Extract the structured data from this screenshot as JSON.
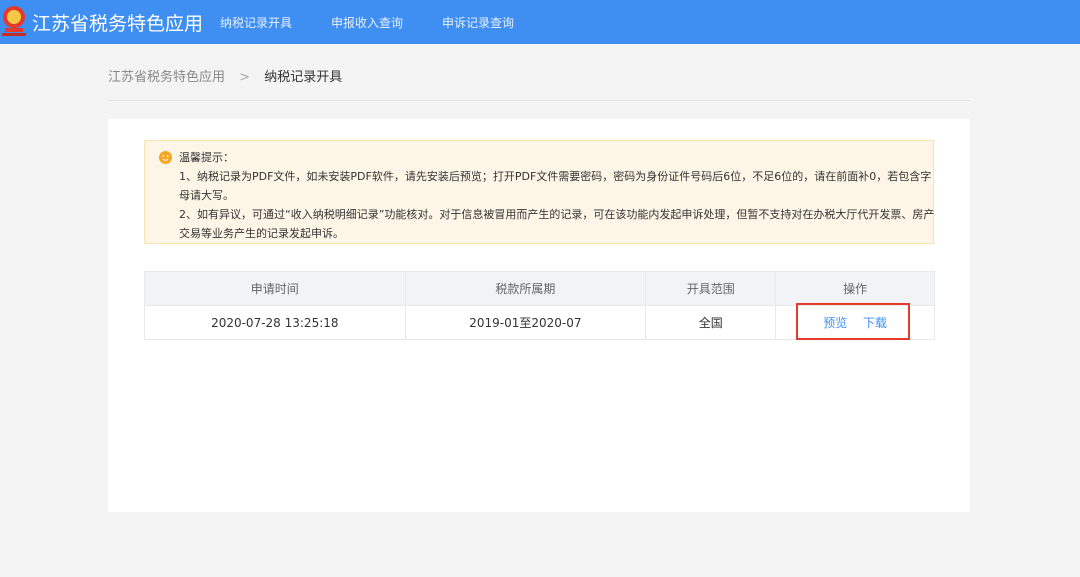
{
  "header": {
    "app_title": "江苏省税务特色应用",
    "nav": [
      "纳税记录开具",
      "申报收入查询",
      "申诉记录查询"
    ]
  },
  "breadcrumb": {
    "root": "江苏省税务特色应用",
    "separator": ">",
    "current": "纳税记录开具"
  },
  "notice": {
    "title": "温馨提示：",
    "line1": "1、纳税记录为PDF文件，如未安装PDF软件，请先安装后预览；打开PDF文件需要密码，密码为身份证件号码后6位，不足6位的，请在前面补0，若包含字母请大写。",
    "line2": "2、如有异议，可通过“收入纳税明细记录”功能核对。对于信息被冒用而产生的记录，可在该功能内发起申诉处理，但暂不支持对在办税大厅代开发票、房产交易等业务产生的记录发起申诉。"
  },
  "table": {
    "headers": [
      "申请时间",
      "税款所属期",
      "开具范围",
      "操作"
    ],
    "rows": [
      {
        "time": "2020-07-28 13:25:18",
        "period": "2019-01至2020-07",
        "scope": "全国",
        "preview": "预览",
        "download": "下载"
      }
    ]
  },
  "colors": {
    "header_bg": "#3f8ef2",
    "link": "#3f8ef2",
    "highlight_border": "#e8392f",
    "notice_bg": "#fdf6e7",
    "notice_icon": "#f5a623"
  }
}
